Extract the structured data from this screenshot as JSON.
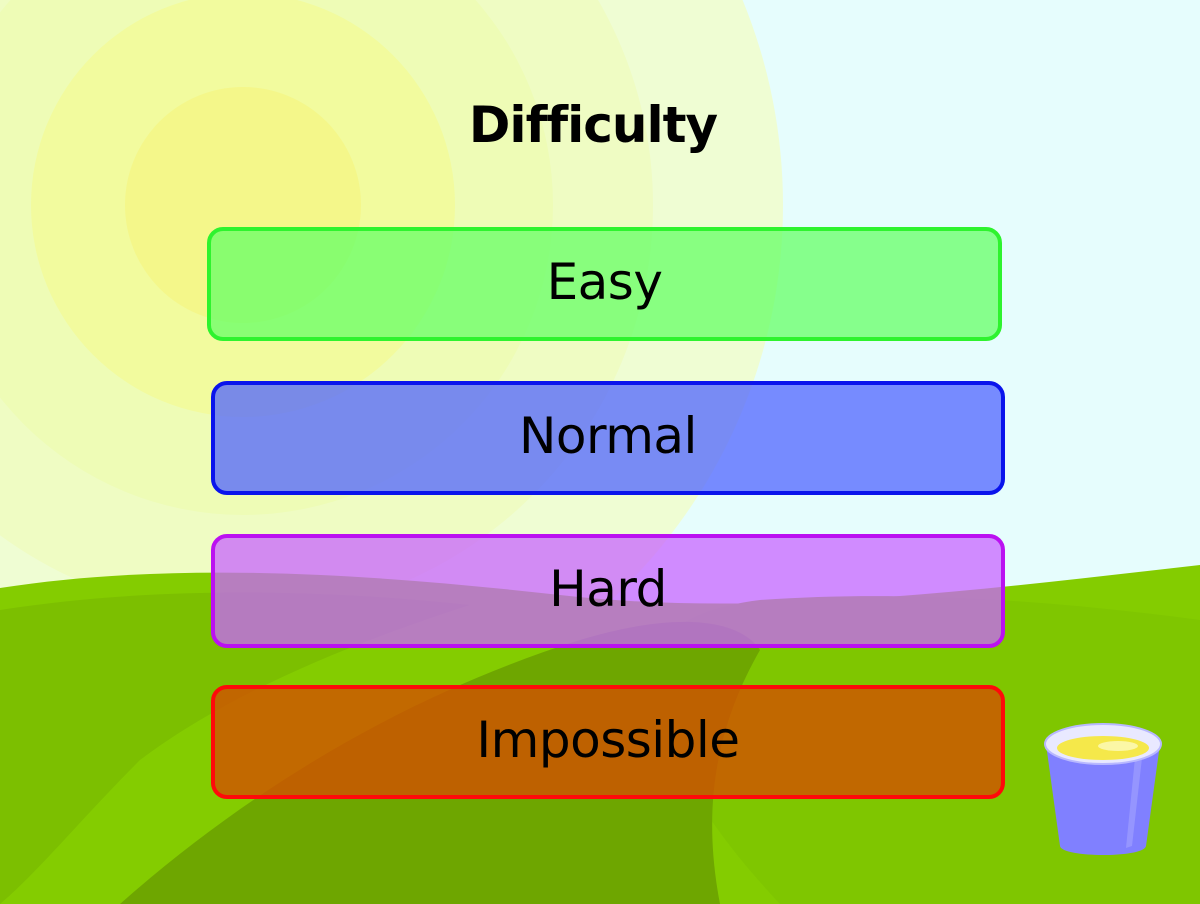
{
  "screen": {
    "title": "Difficulty"
  },
  "options": [
    {
      "label": "Easy",
      "border_color": "#2ef32e",
      "fill_color": "#66ff66"
    },
    {
      "label": "Normal",
      "border_color": "#0a14ec",
      "fill_color": "#5064ff"
    },
    {
      "label": "Hard",
      "border_color": "#bb11f1",
      "fill_color": "#c864ff"
    },
    {
      "label": "Impossible",
      "border_color": "#ff0a0a",
      "fill_color": "#d25000"
    }
  ],
  "colors": {
    "sky": "#e6fdfd",
    "sun": "#f8f88a",
    "grass": "#84cc00",
    "cup": "#8080ff",
    "juice": "#f5e84a"
  },
  "icons": [
    "sun-icon",
    "cup-icon"
  ]
}
